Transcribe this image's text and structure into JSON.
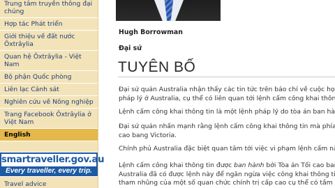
{
  "sidebar": {
    "items": [
      {
        "label": "Trung tâm truyền thông đại chúng",
        "lines": [
          "Trung tâm truyền thông đại",
          "chúng"
        ]
      },
      {
        "label": "Hợp tác Phát triển"
      },
      {
        "label": "Giới thiệu về đất nước Ôxtrâylia",
        "lines": [
          "Giới thiệu về đất nước",
          "Ôxtrâylia"
        ]
      },
      {
        "label": "Quan hệ Ôxtrâylia - Việt Nam"
      },
      {
        "label": "Bộ phận Quốc phòng"
      },
      {
        "label": "Liên lạc Cảnh sát"
      },
      {
        "label": "Nghiên cứu về Nông nghiệp"
      },
      {
        "label": "Trang Facebook Ôxtrâylia ở Việt Nam",
        "lines": [
          "Trang Facebook Ôxtrâylia ở",
          "Việt Nam"
        ]
      },
      {
        "label": "English",
        "active": true
      }
    ],
    "banner": {
      "site": "smartraveller.gov.au",
      "tagline": "Every traveller, every trip."
    },
    "travel_advice": "Travel advice"
  },
  "main": {
    "person_name": "Hugh Borrowman",
    "person_role": "Đại sứ",
    "heading": "TUYÊN BỐ",
    "paragraphs": [
      {
        "lines": [
          "Đại sứ quán Australia nhận thấy các tin tức trên báo chí về cuộc họp giữa Ng",
          "pháp lý ở Australia, cụ thể có liên quan tới lệnh cấm công khai thông tin."
        ]
      },
      {
        "lines": [
          "Lệnh cấm công khai thông tin là một lệnh pháp lý do tòa án ban hành nhằm n"
        ]
      },
      {
        "lines": [
          "Đại sứ quán nhấn mạnh rằng lệnh cấm công khai thông tin mà phía Việt Nam",
          "cao bang Victoria."
        ]
      },
      {
        "lines": [
          "Chính phủ Australia đặc biệt quan tâm tới việc vi phạm lệnh cấm này và vụ vi"
        ]
      },
      {
        "lines": [
          "Lệnh cấm công khai thông tin được |ban hành| bởi Tòa án Tối cao bang Victo",
          "Australia đã có được lệnh này để ngăn ngừa việc công khai thông tin mà có",
          "tham nhũng của một số quan chức chính trị cấp cao cụ thể có tầm ảnh hưởng"
        ]
      }
    ]
  },
  "colors": {
    "sidebar_bg": "#f3e3b8",
    "active_bg": "#e5b84b",
    "link": "#1f3f7a",
    "banner_blue": "#1c5aa3"
  }
}
